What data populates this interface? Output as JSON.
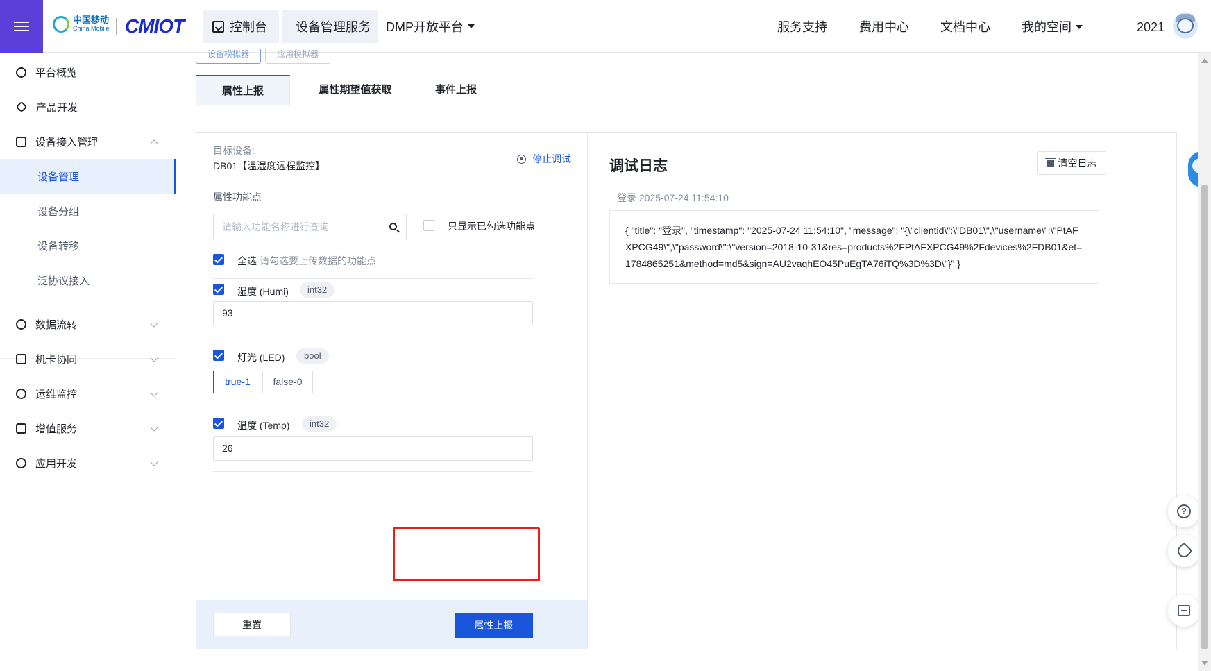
{
  "header": {
    "logo_cn": "中国移动",
    "logo_en": "China Mobile",
    "logo_brand": "CMIOT",
    "nav_console": "控制台",
    "nav_device_service": "设备管理服务",
    "nav_dmp": "DMP开放平台",
    "right_links": [
      "服务支持",
      "费用中心",
      "文档中心",
      "我的空间"
    ],
    "user_name": "2021"
  },
  "sidebar": {
    "items": [
      {
        "label": "平台概览",
        "icon": "gear-icon"
      },
      {
        "label": "产品开发",
        "icon": "cube-icon"
      },
      {
        "label": "设备接入管理",
        "icon": "device-access-icon"
      },
      {
        "label": "数据流转",
        "icon": "data-flow-icon"
      },
      {
        "label": "机卡协同",
        "icon": "link-icon"
      },
      {
        "label": "运维监控",
        "icon": "monitor-icon"
      },
      {
        "label": "增值服务",
        "icon": "send-icon"
      },
      {
        "label": "应用开发",
        "icon": "app-dev-icon"
      }
    ],
    "sub_items": [
      "设备管理",
      "设备分组",
      "设备转移",
      "泛协议接入"
    ],
    "active_sub": "设备管理"
  },
  "main": {
    "sim_tabs": [
      "设备模拟器",
      "应用模拟器"
    ],
    "tabs": [
      "属性上报",
      "属性期望值获取",
      "事件上报"
    ],
    "active_tab": "属性上报",
    "target_label": "目标设备:",
    "target_value": "DB01【温湿度远程监控】",
    "stop_debug": "停止调试",
    "property_label": "属性功能点",
    "search_placeholder": "请输入功能名称进行查询",
    "only_selected_label": "只显示已勾选功能点",
    "select_all_label": "全选",
    "select_all_hint": "请勾选要上传数据的功能点",
    "properties": [
      {
        "name": "湿度 (Humi)",
        "type": "int32",
        "value": "93"
      },
      {
        "name": "灯光 (LED)",
        "type": "bool",
        "options": [
          "true-1",
          "false-0"
        ],
        "selected": "true-1"
      },
      {
        "name": "温度 (Temp)",
        "type": "int32",
        "value": "26"
      }
    ],
    "reset_button": "重置",
    "submit_button": "属性上报"
  },
  "log": {
    "title": "调试日志",
    "clear_button": "清空日志",
    "entry_meta": "登录 2025-07-24 11:54:10",
    "entry_body": "{ \"title\": \"登录\", \"timestamp\": \"2025-07-24 11:54:10\", \"message\": \"{\\\"clientid\\\":\\\"DB01\\\",\\\"username\\\":\\\"PtAFXPCG49\\\",\\\"password\\\":\\\"version=2018-10-31&res=products%2FPtAFXPCG49%2Fdevices%2FDB01&et=1784865251&method=md5&sign=AU2vaqhEO45PuEgTA76iTQ%3D%3D\\\"}\" }"
  },
  "colors": {
    "accent": "#1a56db",
    "menu_bg": "#5b3fd9",
    "highlight": "#e8201a"
  }
}
